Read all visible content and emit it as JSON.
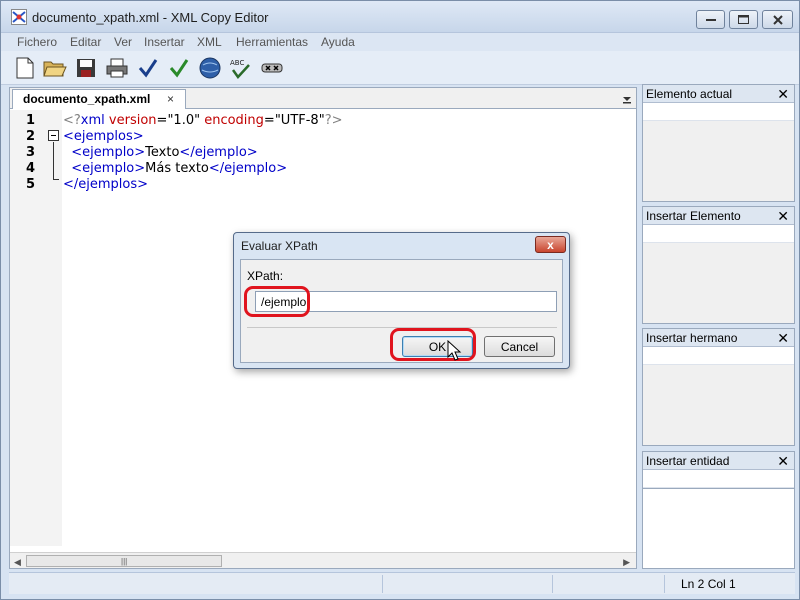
{
  "window": {
    "title": "documento_xpath.xml - XML Copy Editor"
  },
  "menubar": {
    "items": [
      "Fichero",
      "Editar",
      "Ver",
      "Insertar",
      "XML",
      "Herramientas",
      "Ayuda"
    ]
  },
  "toolbar": {
    "icons": [
      "new-document-icon",
      "open-folder-icon",
      "save-icon",
      "print-icon",
      "check-wellformed-icon",
      "validate-icon",
      "browser-icon",
      "spellcheck-icon",
      "xslt-icon"
    ]
  },
  "tab": {
    "label": "documento_xpath.xml",
    "close": "×"
  },
  "editor": {
    "line_numbers": [
      "1",
      "2",
      "3",
      "4",
      "5"
    ],
    "lines": {
      "l1": {
        "p1": "<?",
        "t1": "xml",
        "s1": " ",
        "a1": "version",
        "e1": "=",
        "v1": "\"1.0\"",
        "s2": " ",
        "a2": "encoding",
        "e2": "=",
        "v2": "\"UTF-8\"",
        "p2": "?>"
      },
      "l2": {
        "p1": "<",
        "t1": "ejemplos",
        "p2": ">"
      },
      "l3": {
        "indent": "  ",
        "p1": "<",
        "t1": "ejemplo",
        "p2": ">",
        "text": "Texto",
        "p3": "</",
        "t2": "ejemplo",
        "p4": ">"
      },
      "l4": {
        "indent": "  ",
        "p1": "<",
        "t1": "ejemplo",
        "p2": ">",
        "text": "Más texto",
        "p3": "</",
        "t2": "ejemplo",
        "p4": ">"
      },
      "l5": {
        "p1": "</",
        "t1": "ejemplos",
        "p2": ">"
      }
    }
  },
  "panels": [
    {
      "title": "Elemento actual"
    },
    {
      "title": "Insertar Elemento"
    },
    {
      "title": "Insertar hermano"
    },
    {
      "title": "Insertar entidad"
    }
  ],
  "statusbar": {
    "position": "Ln 2 Col 1"
  },
  "dialog": {
    "title": "Evaluar XPath",
    "label": "XPath:",
    "value": "/ejemplo",
    "ok": "OK",
    "cancel": "Cancel",
    "close": "x"
  },
  "colors": {
    "tag": "#0000c8",
    "attr": "#c00000",
    "punct": "#808080",
    "highlight": "#e0141e"
  }
}
